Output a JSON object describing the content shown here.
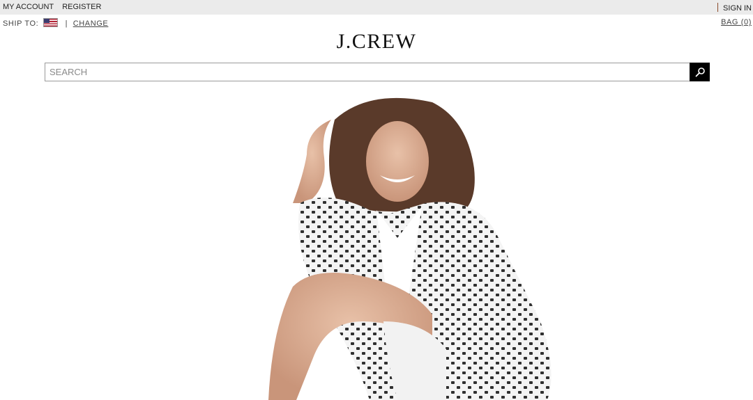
{
  "topbar": {
    "my_account": "MY ACCOUNT",
    "register": "REGISTER",
    "sign_in": "SIGN IN"
  },
  "ship": {
    "label": "SHIP TO:",
    "flag_icon": "us-flag-icon",
    "separator": "|",
    "change": "CHANGE"
  },
  "bag": {
    "label": "BAG (0)"
  },
  "logo": {
    "text": "J.CREW"
  },
  "search": {
    "placeholder": "SEARCH",
    "value": "",
    "button_icon": "search-icon"
  },
  "hero": {
    "image": "model-in-polka-dot-jacket"
  },
  "colors": {
    "topbar_bg": "#ebebeb",
    "search_button": "#000000",
    "jacket_dots": "#1a1a1a"
  }
}
